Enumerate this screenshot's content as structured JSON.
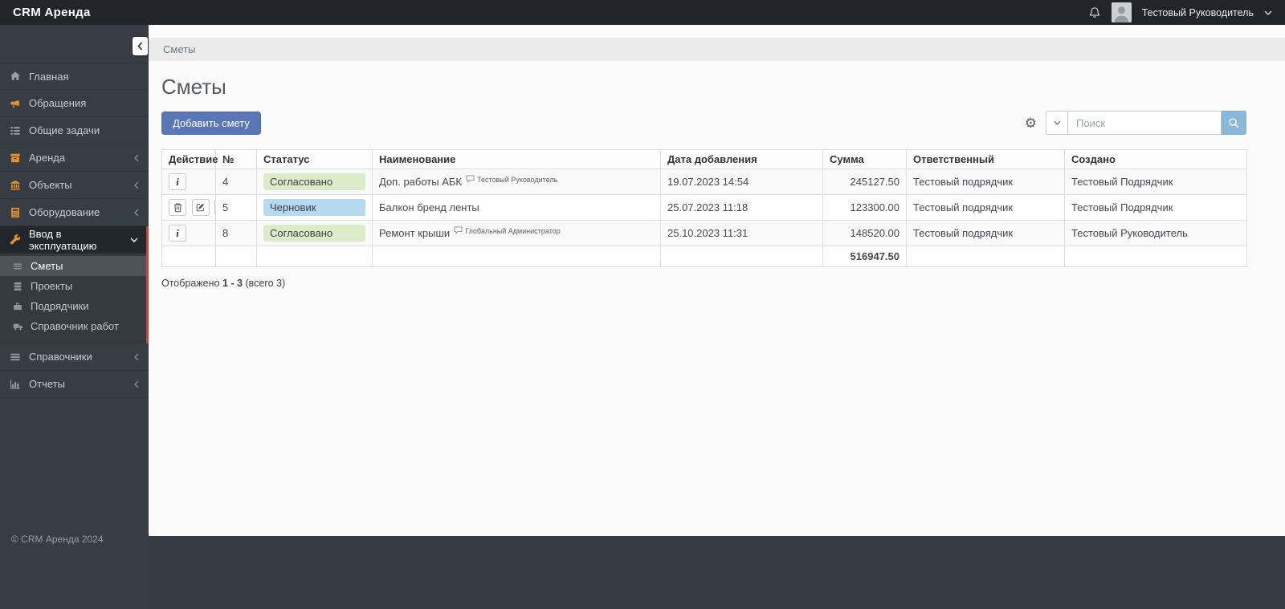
{
  "app": {
    "brand": "CRM Аренда"
  },
  "topbar": {
    "user_name": "Тестовый Руководитель"
  },
  "breadcrumb": {
    "current": "Сметы"
  },
  "sidebar": {
    "items": [
      {
        "label": "Главная"
      },
      {
        "label": "Обращения"
      },
      {
        "label": "Общие задачи"
      },
      {
        "label": "Аренда"
      },
      {
        "label": "Объекты"
      },
      {
        "label": "Оборудование"
      },
      {
        "label": "Ввод в эксплуатацию"
      }
    ],
    "submenu": [
      {
        "label": "Сметы"
      },
      {
        "label": "Проекты"
      },
      {
        "label": "Подрядчики"
      },
      {
        "label": "Справочник работ"
      }
    ],
    "bottom_items": [
      {
        "label": "Справочники"
      },
      {
        "label": "Отчеты"
      }
    ]
  },
  "page": {
    "title": "Сметы",
    "add_button_label": "Добавить смету"
  },
  "search": {
    "placeholder": "Поиск"
  },
  "table": {
    "headers": {
      "action": "Действие",
      "num": "№",
      "status": "Стататус",
      "name": "Наименование",
      "date": "Дата добавления",
      "sum": "Сумма",
      "responsible": "Ответственный",
      "created": "Создано"
    },
    "rows": [
      {
        "num": "4",
        "status": "Согласовано",
        "name": "Доп. работы АБК",
        "comment": "Тестовый Руководитель",
        "date": "19.07.2023 14:54",
        "sum": "245127.50",
        "responsible": "Тестовый подрядчик",
        "created": "Тестовый Подрядчик"
      },
      {
        "num": "5",
        "status": "Черновик",
        "name": "Балкон бренд ленты",
        "date": "25.07.2023 11:18",
        "sum": "123300.00",
        "responsible": "Тестовый подрядчик",
        "created": "Тестовый Подрядчик"
      },
      {
        "num": "8",
        "status": "Согласовано",
        "name": "Ремонт крыши",
        "comment": "Глобальный Администратор",
        "date": "25.10.2023 11:31",
        "sum": "148520.00",
        "responsible": "Тестовый подрядчик",
        "created": "Тестовый Руководитель"
      }
    ],
    "total_sum": "516947.50",
    "summary": {
      "before": "Отображено",
      "range": "1 - 3",
      "after": "(всего 3)"
    }
  },
  "footer": {
    "copyright": "© CRM Аренда 2024"
  },
  "colors": {
    "accent_orange": "#e8912d",
    "stripe_red": "#c04437",
    "primary_button": "#5b76b7",
    "search_button": "#8ab8d9",
    "badge_green": "#dcebc8",
    "badge_blue": "#b7d9f0"
  }
}
